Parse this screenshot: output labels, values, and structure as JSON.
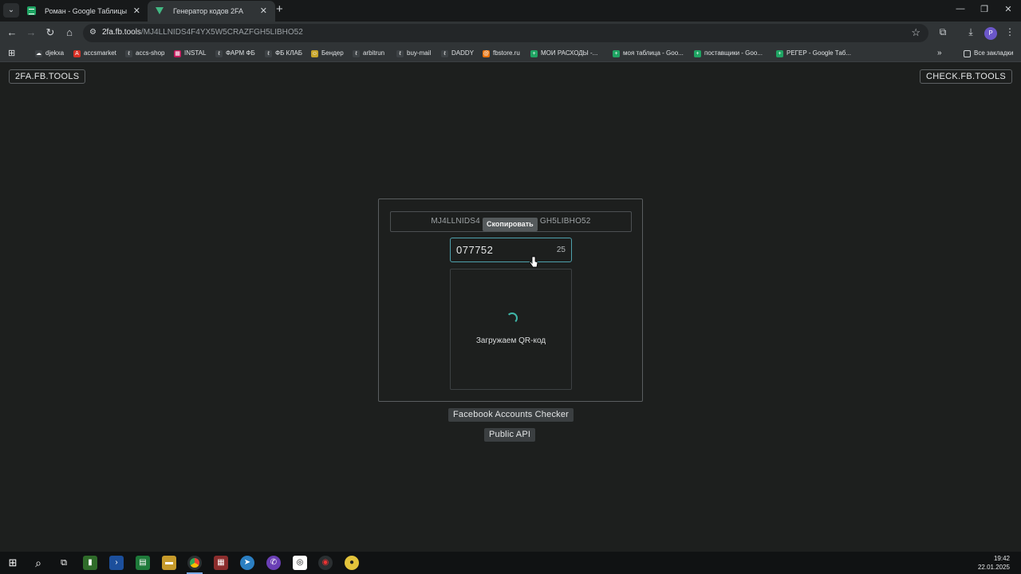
{
  "browser": {
    "tabs": [
      {
        "title": "Роман - Google Таблицы",
        "favicon": "google-sheets-icon"
      },
      {
        "title": "Генератор кодов 2FA",
        "favicon": "vue-icon"
      }
    ],
    "address": {
      "host": "2fa.fb.tools",
      "path": "/MJ4LLNIDS4F4YX5W5CRAZFGH5LIBHO52"
    },
    "profile_initial": "P",
    "bookmarks": [
      {
        "label": "djekxa",
        "icon": "cloud-icon"
      },
      {
        "label": "accsmarket",
        "icon": "a-logo-icon"
      },
      {
        "label": "accs-shop",
        "icon": "link-icon"
      },
      {
        "label": "INSTAL",
        "icon": "grid-icon"
      },
      {
        "label": "ФАРМ ФБ",
        "icon": "link-icon"
      },
      {
        "label": "ФБ КЛАБ",
        "icon": "link-icon"
      },
      {
        "label": "Бендер",
        "icon": "person-icon"
      },
      {
        "label": "arbitrun",
        "icon": "link-icon"
      },
      {
        "label": "buy-mail",
        "icon": "link-icon"
      },
      {
        "label": "DADDY",
        "icon": "link-icon"
      },
      {
        "label": "fbstore.ru",
        "icon": "store-icon"
      },
      {
        "label": "МОИ РАСХОДЫ -...",
        "icon": "google-sheets-icon"
      },
      {
        "label": "моя таблица - Goo...",
        "icon": "google-sheets-icon"
      },
      {
        "label": "поставщики - Goo...",
        "icon": "google-sheets-icon"
      },
      {
        "label": "РЕГЕР - Google Таб...",
        "icon": "google-sheets-icon"
      }
    ],
    "all_bookmarks": "Все закладки"
  },
  "page": {
    "left_button": "2FA.FB.TOOLS",
    "right_button": "CHECK.FB.TOOLS",
    "secret_left": "MJ4LLNIDS4",
    "secret_right": "GH5LIBHO52",
    "copy_tooltip": "Скопировать",
    "code": "077752",
    "timer": "25",
    "qr_loading": "Загружаем QR-код",
    "checker_link": "Facebook Accounts Checker",
    "api_link": "Public API"
  },
  "taskbar": {
    "time": "19:42",
    "date": "22.01.2025"
  }
}
